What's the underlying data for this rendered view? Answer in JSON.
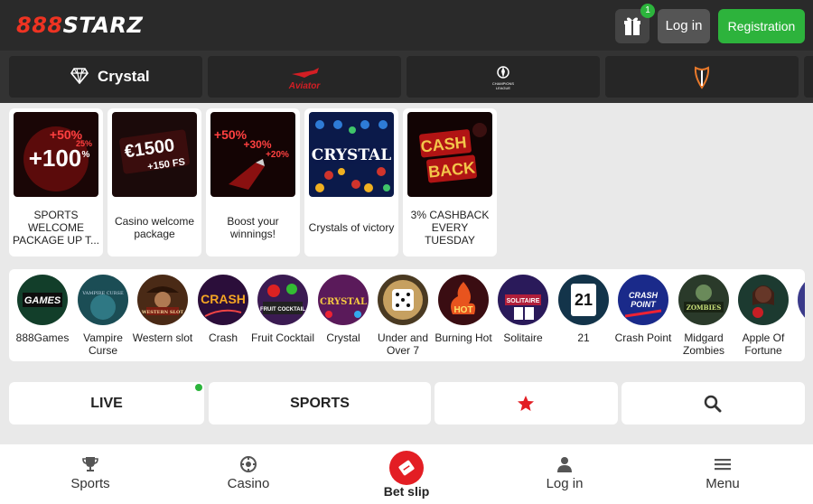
{
  "header": {
    "logo_prefix": "888",
    "logo_text": "STARZ",
    "gift_badge": "1",
    "login_label": "Log in",
    "register_label": "Registration"
  },
  "promo_tabs": [
    {
      "label": "Crystal",
      "icon": "diamond-icon"
    },
    {
      "label": "Aviator",
      "icon": "aviator-logo"
    },
    {
      "label": "CHAMPIONS LEAGUE",
      "icon": "champions-league-logo"
    },
    {
      "label": "",
      "icon": "europa-league-logo"
    }
  ],
  "bonuses": [
    {
      "title": "SPORTS WELCOME PACKAGE UP T...",
      "art": "+100% +50% +25%"
    },
    {
      "title": "Casino welcome package",
      "art": "€1500 +150 FS"
    },
    {
      "title": "Boost your winnings!",
      "art": "+50% +30% +20%"
    },
    {
      "title": "Crystals of victory",
      "art": "CRYSTAL"
    },
    {
      "title": "3% CASHBACK EVERY TUESDAY",
      "art": "CASH BACK"
    }
  ],
  "games": [
    {
      "label": "888Games",
      "art": "GAMES"
    },
    {
      "label": "Vampire Curse",
      "art": "VAMPIRE CURSE"
    },
    {
      "label": "Western slot",
      "art": "WESTERN SLOT"
    },
    {
      "label": "Crash",
      "art": "CRASH"
    },
    {
      "label": "Fruit Cocktail",
      "art": "FRUIT COCKTAIL"
    },
    {
      "label": "Crystal",
      "art": "CRYSTAL"
    },
    {
      "label": "Under and Over 7",
      "art": ""
    },
    {
      "label": "Burning Hot",
      "art": "HOT"
    },
    {
      "label": "Solitaire",
      "art": "SOLITAIRE"
    },
    {
      "label": "21",
      "art": "21"
    },
    {
      "label": "Crash Point",
      "art": "CRASH POINT"
    },
    {
      "label": "Midgard Zombies",
      "art": "ZOMBIES"
    },
    {
      "label": "Apple Of Fortune",
      "art": ""
    }
  ],
  "nav": {
    "live_label": "LIVE",
    "sports_label": "SPORTS",
    "favorites_icon": "star-icon",
    "search_icon": "search-icon"
  },
  "tabbar": {
    "sports": "Sports",
    "casino": "Casino",
    "bet_slip": "Bet slip",
    "login": "Log in",
    "menu": "Menu"
  },
  "colors": {
    "header_bg": "#2a2a2a",
    "register_green": "#2db33c",
    "accent_red": "#e31e24"
  }
}
